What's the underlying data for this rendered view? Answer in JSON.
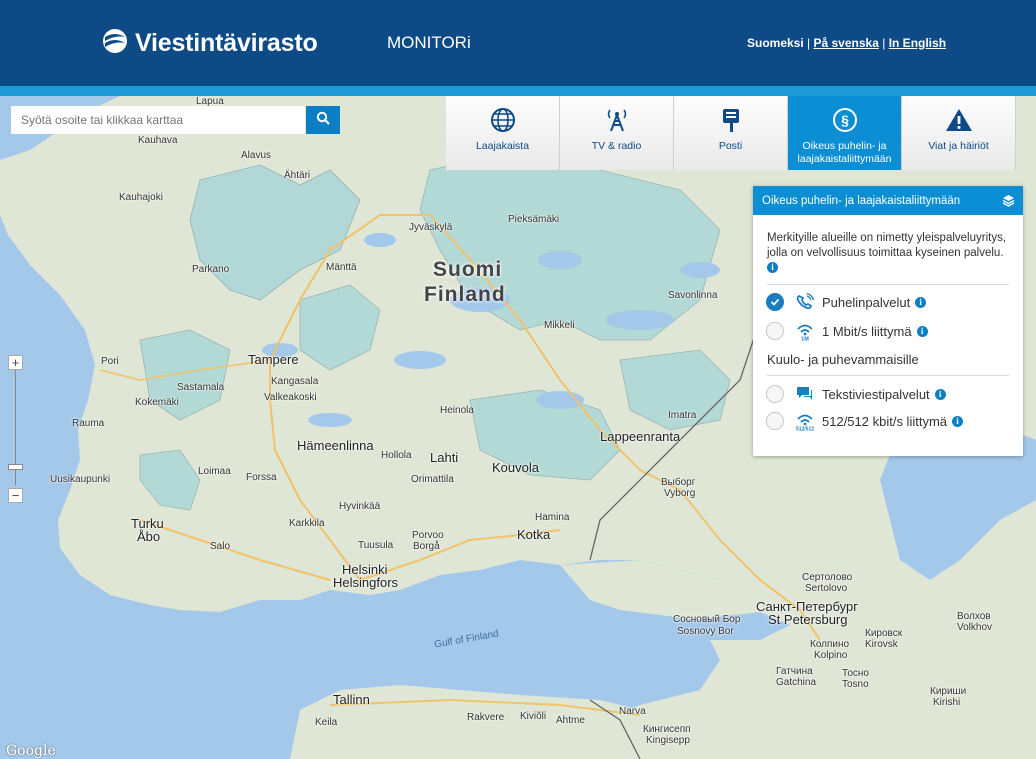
{
  "header": {
    "brand": "Viestintävirasto",
    "app_name": "MONITORi",
    "languages": {
      "current": "Suomeksi",
      "swedish": "På svenska",
      "english": "In English"
    }
  },
  "search": {
    "placeholder": "Syötä osoite tai klikkaa karttaa"
  },
  "tabs": [
    {
      "label": "Laajakaista",
      "icon": "globe-icon"
    },
    {
      "label": "TV & radio",
      "icon": "antenna-tower-icon"
    },
    {
      "label": "Posti",
      "icon": "mailbox-icon"
    },
    {
      "label": "Oikeus puhelin- ja laajakaistaliittymään",
      "icon": "law-paragraph-icon",
      "active": true
    },
    {
      "label": "Viat ja häiriöt",
      "icon": "warning-icon"
    }
  ],
  "panel": {
    "title": "Oikeus puhelin- ja laajakaistaliittymään",
    "description": "Merkityille alueille on nimetty yleispalveluyritys, jolla on velvollisuus toimittaa kyseinen palvelu.",
    "options": [
      {
        "label": "Puhelinpalvelut",
        "icon": "phone-icon",
        "selected": true
      },
      {
        "label": "1 Mbit/s liittymä",
        "icon": "wifi-1m-icon",
        "selected": false
      }
    ],
    "subheading": "Kuulo- ja puhevammaisille",
    "options2": [
      {
        "label": "Tekstiviestipalvelut",
        "icon": "chat-icon",
        "selected": false
      },
      {
        "label": "512/512 kbit/s liittymä",
        "icon": "wifi-512-icon",
        "selected": false
      }
    ]
  },
  "map": {
    "country": [
      "Suomi",
      "Finland"
    ],
    "cities": [
      "Lapua",
      "Kauhava",
      "Alavus",
      "Ähtäri",
      "Kauhajoki",
      "Parkano",
      "Jyväskylä",
      "Mänttä",
      "Pieksämäki",
      "Savonlinna",
      "Mikkeli",
      "Pori",
      "Tampere",
      "Kangasala",
      "Sastamala",
      "Valkeakoski",
      "Kokemäki",
      "Rauma",
      "Heinola",
      "Imatra",
      "Hämeenlinna",
      "Lahti",
      "Hollola",
      "Lappeenranta",
      "Loimaa",
      "Forssa",
      "Orimattila",
      "Kouvola",
      "Uusikaupunki",
      "Выборг",
      "Vyborg",
      "Turku",
      "Åbo",
      "Hyvinkää",
      "Karkkila",
      "Hamina",
      "Porvoo",
      "Borgå",
      "Kotka",
      "Salo",
      "Tuusula",
      "Helsinki",
      "Helsingfors",
      "Сертолово",
      "Sertolovo",
      "Санкт-Петербург",
      "St Petersburg",
      "Сосновый Бор",
      "Sosnovy Bor",
      "Колпино",
      "Kolpino",
      "Кировск",
      "Kirovsk",
      "Волхов",
      "Volkhov",
      "Гатчина",
      "Gatchina",
      "Тосно",
      "Tosno",
      "Кириши",
      "Kirishi",
      "Tallinn",
      "Keila",
      "Rakvere",
      "Kiviõli",
      "Ahtme",
      "Narva",
      "Кингисепп",
      "Kingisepp"
    ],
    "sea": "Gulf of Finland",
    "attribution": "Google",
    "zoom": {
      "plus": "+",
      "minus": "−"
    }
  },
  "colors": {
    "header": "#0d4a86",
    "accent": "#0c8ed4",
    "water": "#a4c8ea",
    "land": "#dfe6d6",
    "highlight": "#a9d6d7"
  }
}
